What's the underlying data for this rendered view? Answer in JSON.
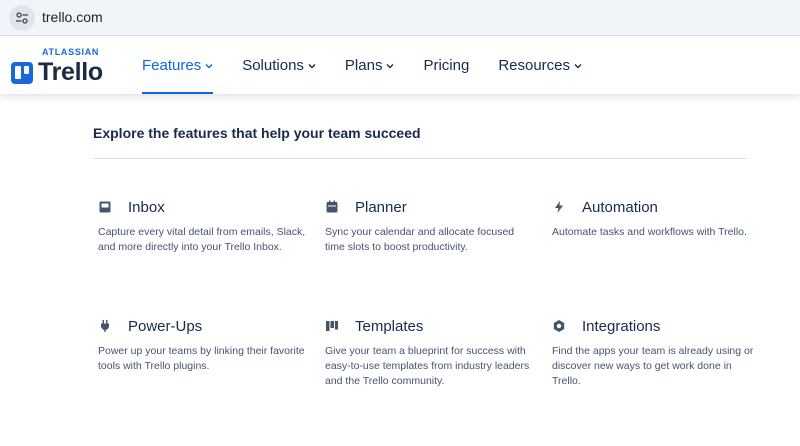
{
  "browser": {
    "url": "trello.com"
  },
  "header": {
    "brand_top": "ATLASSIAN",
    "brand_name": "Trello",
    "brand_color": "#1868db",
    "accent_color": "#0c66e4",
    "nav": [
      {
        "label": "Features",
        "has_dropdown": true,
        "active": true
      },
      {
        "label": "Solutions",
        "has_dropdown": true,
        "active": false
      },
      {
        "label": "Plans",
        "has_dropdown": true,
        "active": false
      },
      {
        "label": "Pricing",
        "has_dropdown": false,
        "active": false
      },
      {
        "label": "Resources",
        "has_dropdown": true,
        "active": false
      }
    ]
  },
  "menu": {
    "heading": "Explore the features that help your team succeed",
    "features": [
      {
        "icon": "inbox-icon",
        "title": "Inbox",
        "description": "Capture every vital detail from emails, Slack, and more directly into your Trello Inbox."
      },
      {
        "icon": "planner-icon",
        "title": "Planner",
        "description": "Sync your calendar and allocate focused time slots to boost productivity."
      },
      {
        "icon": "lightning-icon",
        "title": "Automation",
        "description": "Automate tasks and workflows with Trello."
      },
      {
        "icon": "plug-icon",
        "title": "Power-Ups",
        "description": "Power up your teams by linking their favorite tools with Trello plugins."
      },
      {
        "icon": "templates-icon",
        "title": "Templates",
        "description": "Give your team a blueprint for success with easy-to-use templates from industry leaders and the Trello community."
      },
      {
        "icon": "integrations-icon",
        "title": "Integrations",
        "description": "Find the apps your team is already using or discover new ways to get work done in Trello."
      }
    ]
  }
}
